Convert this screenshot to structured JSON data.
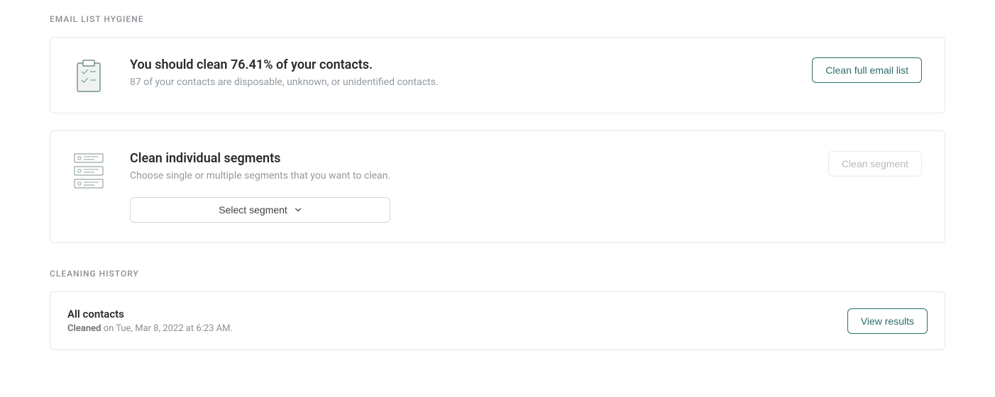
{
  "sections": {
    "hygiene_label": "EMAIL LIST HYGIENE",
    "history_label": "CLEANING HISTORY"
  },
  "clean_all": {
    "title": "You should clean 76.41% of your contacts.",
    "subtitle": "87 of your contacts are disposable, unknown, or unidentified contacts.",
    "button": "Clean full email list"
  },
  "segments": {
    "title": "Clean individual segments",
    "subtitle": "Choose single or multiple segments that you want to clean.",
    "select_label": "Select segment",
    "button": "Clean segment"
  },
  "history": {
    "items": [
      {
        "title": "All contacts",
        "status": "Cleaned",
        "meta": " on Tue, Mar 8, 2022 at 6:23 AM.",
        "button": "View results"
      }
    ]
  }
}
